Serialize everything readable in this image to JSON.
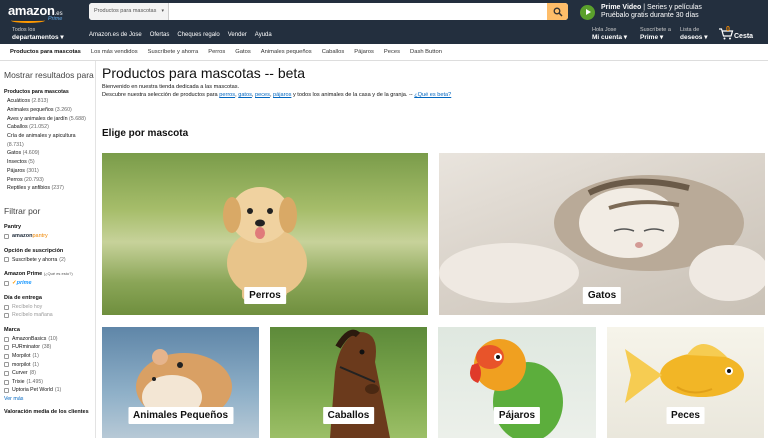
{
  "header": {
    "logo_text": "amazon",
    "logo_tld": ".es",
    "logo_prime": "Prime",
    "search": {
      "category": "Productos para mascotas",
      "placeholder": ""
    },
    "prime_video": {
      "line1_bold": "Prime Video",
      "line1_rest": " | Series y películas",
      "line2": "Pruébalo gratis durante 30 días"
    }
  },
  "nav": {
    "departments": {
      "line1": "Todos los",
      "line2": "departamentos"
    },
    "links": [
      "Amazon.es de Jose",
      "Ofertas",
      "Cheques regalo",
      "Vender",
      "Ayuda"
    ],
    "account": {
      "line1": "Hola Jose",
      "line2": "Mi cuenta"
    },
    "prime": {
      "line1": "Suscríbete a",
      "line2": "Prime"
    },
    "wishlist": {
      "line1": "Lista de",
      "line2": "deseos"
    },
    "cart": {
      "count": "0",
      "label": "Cesta"
    }
  },
  "subnav": [
    "Productos para mascotas",
    "Los más vendidos",
    "Suscríbete y ahorra",
    "Perros",
    "Gatos",
    "Animales pequeños",
    "Caballos",
    "Pájaros",
    "Peces",
    "Dash Button"
  ],
  "sidebar": {
    "show_results": "Mostrar resultados para",
    "cat_head": "Productos para mascotas",
    "categories": [
      {
        "name": "Acuáticos",
        "count": "(2.813)"
      },
      {
        "name": "Animales pequeños",
        "count": "(3.260)"
      },
      {
        "name": "Aves y animales de jardín",
        "count": "(5.688)"
      },
      {
        "name": "Caballos",
        "count": "(21.052)"
      },
      {
        "name": "Cría de animales y apicultura",
        "count": ""
      },
      {
        "name": "",
        "count": "(8.731)"
      },
      {
        "name": "Gatos",
        "count": "(4.609)"
      },
      {
        "name": "Insectos",
        "count": "(5)"
      },
      {
        "name": "Pájaros",
        "count": "(301)"
      },
      {
        "name": "Perros",
        "count": "(20.793)"
      },
      {
        "name": "Reptiles y anfibios",
        "count": "(237)"
      }
    ],
    "filter_title": "Filtrar por",
    "pantry_head": "Pantry",
    "pantry_logo_a": "amazon",
    "pantry_logo_b": "pantry",
    "subscription_head": "Opción de suscripción",
    "subscription_item": "Suscríbete y ahorra",
    "subscription_count": "(2)",
    "prime_head": "Amazon Prime",
    "prime_what": "(¿Qué es esto?)",
    "prime_logo": "prime",
    "delivery_head": "Día de entrega",
    "delivery": [
      "Recíbelo hoy",
      "Recíbelo mañana"
    ],
    "brand_head": "Marca",
    "brands": [
      {
        "name": "AmazonBasics",
        "count": "(10)"
      },
      {
        "name": "FURminator",
        "count": "(38)"
      },
      {
        "name": "Morpilot",
        "count": "(1)"
      },
      {
        "name": "morpilot",
        "count": "(1)"
      },
      {
        "name": "Curver",
        "count": "(8)"
      },
      {
        "name": "Trixie",
        "count": "(1.495)"
      },
      {
        "name": "Uptoria Pet World",
        "count": "(1)"
      }
    ],
    "see_more": "Ver más",
    "cut_text": "Valoración media de los clientes"
  },
  "main": {
    "title": "Productos para mascotas -- beta",
    "intro1": "Bienvenido en nuestra tienda dedicada a las mascotas.",
    "intro2_pre": "Descubre nuestra selección de productos para ",
    "intro2_links": [
      "perros",
      "gatos",
      "peces",
      "pájaros"
    ],
    "intro2_post": " y todos los animales de la casa y de la granja. -- ",
    "intro2_q": "¿Qué es beta?",
    "section": "Elige por mascota",
    "tiles": [
      "Perros",
      "Gatos",
      "Animales Pequeños",
      "Caballos",
      "Pájaros",
      "Peces"
    ]
  },
  "colors": {
    "header_bg": "#232f3e",
    "accent": "#f90",
    "link": "#0066c0",
    "search_button": "#febd69"
  }
}
